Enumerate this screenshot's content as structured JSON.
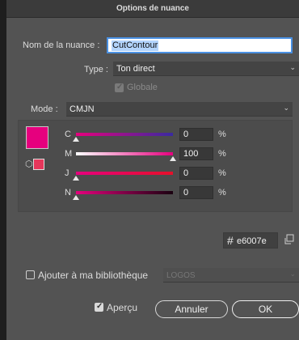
{
  "dialog": {
    "title": "Options de nuance"
  },
  "swatch_name": {
    "label": "Nom de la nuance :",
    "value": "CutContour"
  },
  "type": {
    "label": "Type :",
    "value": "Ton direct"
  },
  "global": {
    "label": "Globale",
    "checked": true,
    "disabled": true
  },
  "mode": {
    "label": "Mode :",
    "value": "CMJN"
  },
  "channels": [
    {
      "label": "C",
      "value": "0",
      "unit": "%",
      "level": 0,
      "gradient": [
        "#e6007e",
        "#3a2aa0"
      ]
    },
    {
      "label": "M",
      "value": "100",
      "unit": "%",
      "level": 100,
      "gradient": [
        "#ffffff",
        "#e6007e"
      ]
    },
    {
      "label": "J",
      "value": "0",
      "unit": "%",
      "level": 0,
      "gradient": [
        "#e6007e",
        "#e6102a"
      ]
    },
    {
      "label": "N",
      "value": "0",
      "unit": "%",
      "level": 0,
      "gradient": [
        "#e6007e",
        "#1a0010"
      ]
    }
  ],
  "hex": {
    "symbol": "#",
    "value": "e6007e"
  },
  "colors": {
    "swatch": "#e6007e",
    "gamut_swatch": "#e6375b"
  },
  "library": {
    "label": "Ajouter à ma bibliothèque",
    "checked": false,
    "select_value": "LOGOS"
  },
  "preview": {
    "label": "Aperçu",
    "checked": true
  },
  "buttons": {
    "cancel": "Annuler",
    "ok": "OK"
  }
}
